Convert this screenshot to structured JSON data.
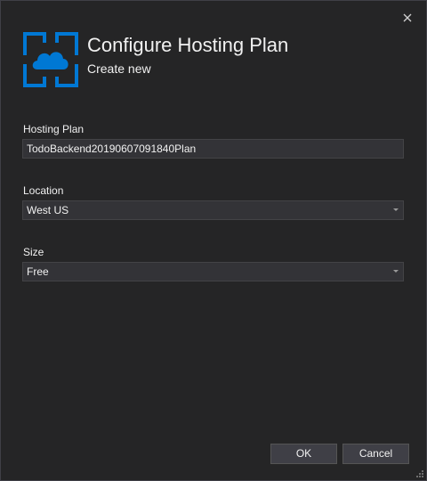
{
  "dialog": {
    "title": "Configure Hosting Plan",
    "subtitle": "Create new"
  },
  "fields": {
    "hosting_plan": {
      "label": "Hosting Plan",
      "value": "TodoBackend20190607091840Plan"
    },
    "location": {
      "label": "Location",
      "value": "West US"
    },
    "size": {
      "label": "Size",
      "value": "Free"
    }
  },
  "buttons": {
    "ok": "OK",
    "cancel": "Cancel"
  },
  "icons": {
    "close": "close-icon",
    "logo": "azure-app-service-icon",
    "dropdown": "chevron-down-icon",
    "resize": "resize-grip-icon"
  },
  "colors": {
    "background": "#252526",
    "accent": "#0078d4",
    "input_background": "#333337",
    "button_background": "#3f3f46"
  }
}
